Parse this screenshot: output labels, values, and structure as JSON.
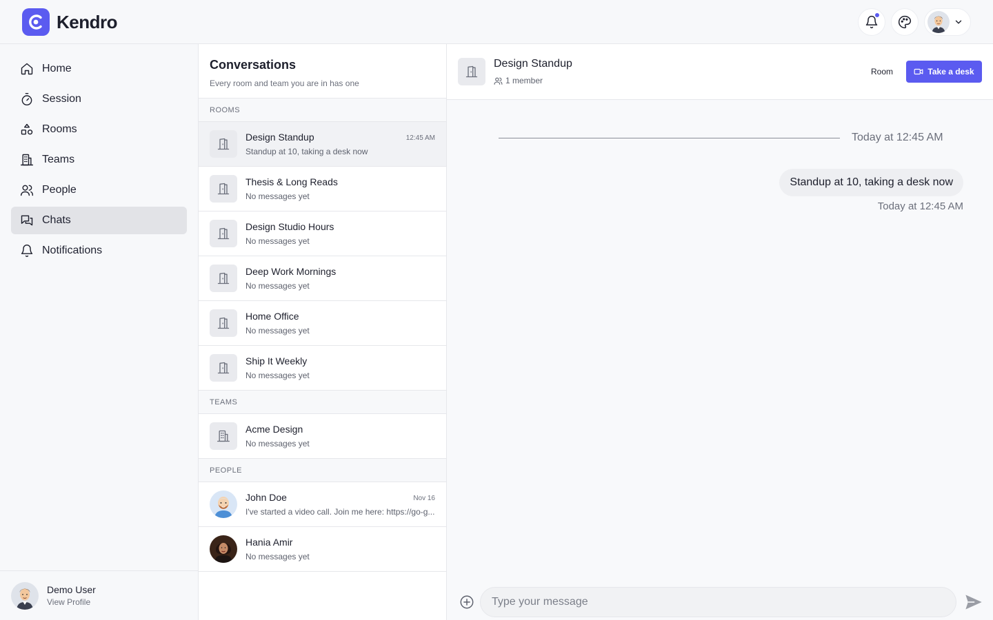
{
  "app": {
    "name": "Kendro",
    "accent_color": "#5b5bf0"
  },
  "header": {
    "notifications_icon": "bell-icon",
    "theme_icon": "palette-icon",
    "user_menu_icon": "chevron-down-icon"
  },
  "sidebar": {
    "items": [
      {
        "label": "Home",
        "icon": "home-icon"
      },
      {
        "label": "Session",
        "icon": "timer-icon"
      },
      {
        "label": "Rooms",
        "icon": "rooms-icon"
      },
      {
        "label": "Teams",
        "icon": "building-icon"
      },
      {
        "label": "People",
        "icon": "people-icon"
      },
      {
        "label": "Chats",
        "icon": "chats-icon",
        "active": true
      },
      {
        "label": "Notifications",
        "icon": "bell-icon"
      }
    ],
    "profile": {
      "name": "Demo User",
      "link": "View Profile"
    }
  },
  "conversations": {
    "title": "Conversations",
    "subtitle": "Every room and team you are in has one",
    "sections": {
      "rooms": "ROOMS",
      "teams": "TEAMS",
      "people": "PEOPLE"
    },
    "rooms": [
      {
        "name": "Design Standup",
        "last": "Standup at 10, taking a desk now",
        "time": "12:45 AM",
        "active": true
      },
      {
        "name": "Thesis & Long Reads",
        "last": "No messages yet",
        "time": ""
      },
      {
        "name": "Design Studio Hours",
        "last": "No messages yet",
        "time": ""
      },
      {
        "name": "Deep Work Mornings",
        "last": "No messages yet",
        "time": ""
      },
      {
        "name": "Home Office",
        "last": "No messages yet",
        "time": ""
      },
      {
        "name": "Ship It Weekly",
        "last": "No messages yet",
        "time": ""
      }
    ],
    "teams": [
      {
        "name": "Acme Design",
        "last": "No messages yet",
        "time": ""
      }
    ],
    "people": [
      {
        "name": "John Doe",
        "last": "I've started a video call. Join me here: https://go-g...",
        "time": "Nov 16"
      },
      {
        "name": "Hania Amir",
        "last": "No messages yet",
        "time": ""
      }
    ]
  },
  "chat": {
    "title": "Design Standup",
    "members": "1 member",
    "room_button": "Room",
    "desk_button": "Take a desk",
    "divider": "Today at 12:45 AM",
    "message": {
      "text": "Standup at 10, taking a desk now",
      "time": "Today at 12:45 AM"
    },
    "composer": {
      "placeholder": "Type your message"
    }
  }
}
